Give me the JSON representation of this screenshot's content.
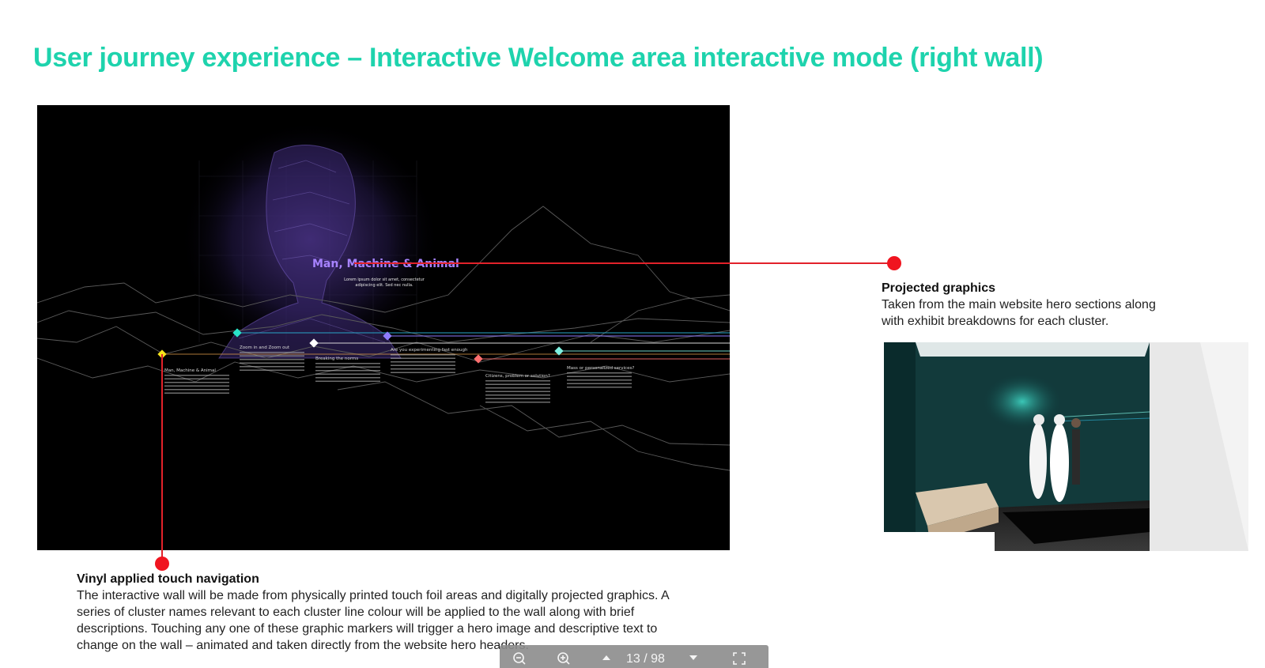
{
  "slide": {
    "title": "User journey experience – Interactive Welcome area interactive mode (right wall)"
  },
  "projection": {
    "heading": "Man, Machine & Animal",
    "subtext": "Lorem ipsum dolor sit amet, consectetur adipiscing elit. Sed nec nulla.",
    "markers": [
      {
        "label": "Man, Machine & Animal",
        "color": "#f5e21b"
      },
      {
        "label": "Zoom in and Zoom out",
        "color": "#29e3c8"
      },
      {
        "label": "Breaking the norms",
        "color": "#ffffff"
      },
      {
        "label": "Are you experimenting fast enough",
        "color": "#8f7cff"
      },
      {
        "label": "Citizens, problem or solution?",
        "color": "#ff6f6f"
      },
      {
        "label": "Mass or personalized services?",
        "color": "#7ef0e0"
      }
    ]
  },
  "captions": {
    "projected": {
      "title": "Projected graphics",
      "line1": "Taken from the main website hero sections along",
      "line2": "with exhibit breakdowns for each cluster."
    },
    "vinyl": {
      "title": "Vinyl applied touch navigation",
      "line1": "The interactive wall will be made from physically printed touch foil areas and digitally projected graphics. A",
      "line2": "series of cluster names relevant to each cluster line colour will be applied to the wall along with brief",
      "line3": "descriptions. Touching any one of these graphic markers will trigger a hero image and descriptive text to",
      "line4": "change on the wall – animated and taken directly from the website hero headers."
    }
  },
  "toolbar": {
    "zoom_out_icon": "zoom-out-icon",
    "zoom_in_icon": "zoom-in-icon",
    "prev_icon": "chevron-up-icon",
    "next_icon": "chevron-down-icon",
    "fullscreen_icon": "fullscreen-icon",
    "current_page": "13",
    "page_separator": " / ",
    "total_pages": "98"
  },
  "colors": {
    "title": "#1ed3ad",
    "connector": "#e2222a",
    "dot": "#f0141f",
    "panel_bg": "#000000"
  }
}
